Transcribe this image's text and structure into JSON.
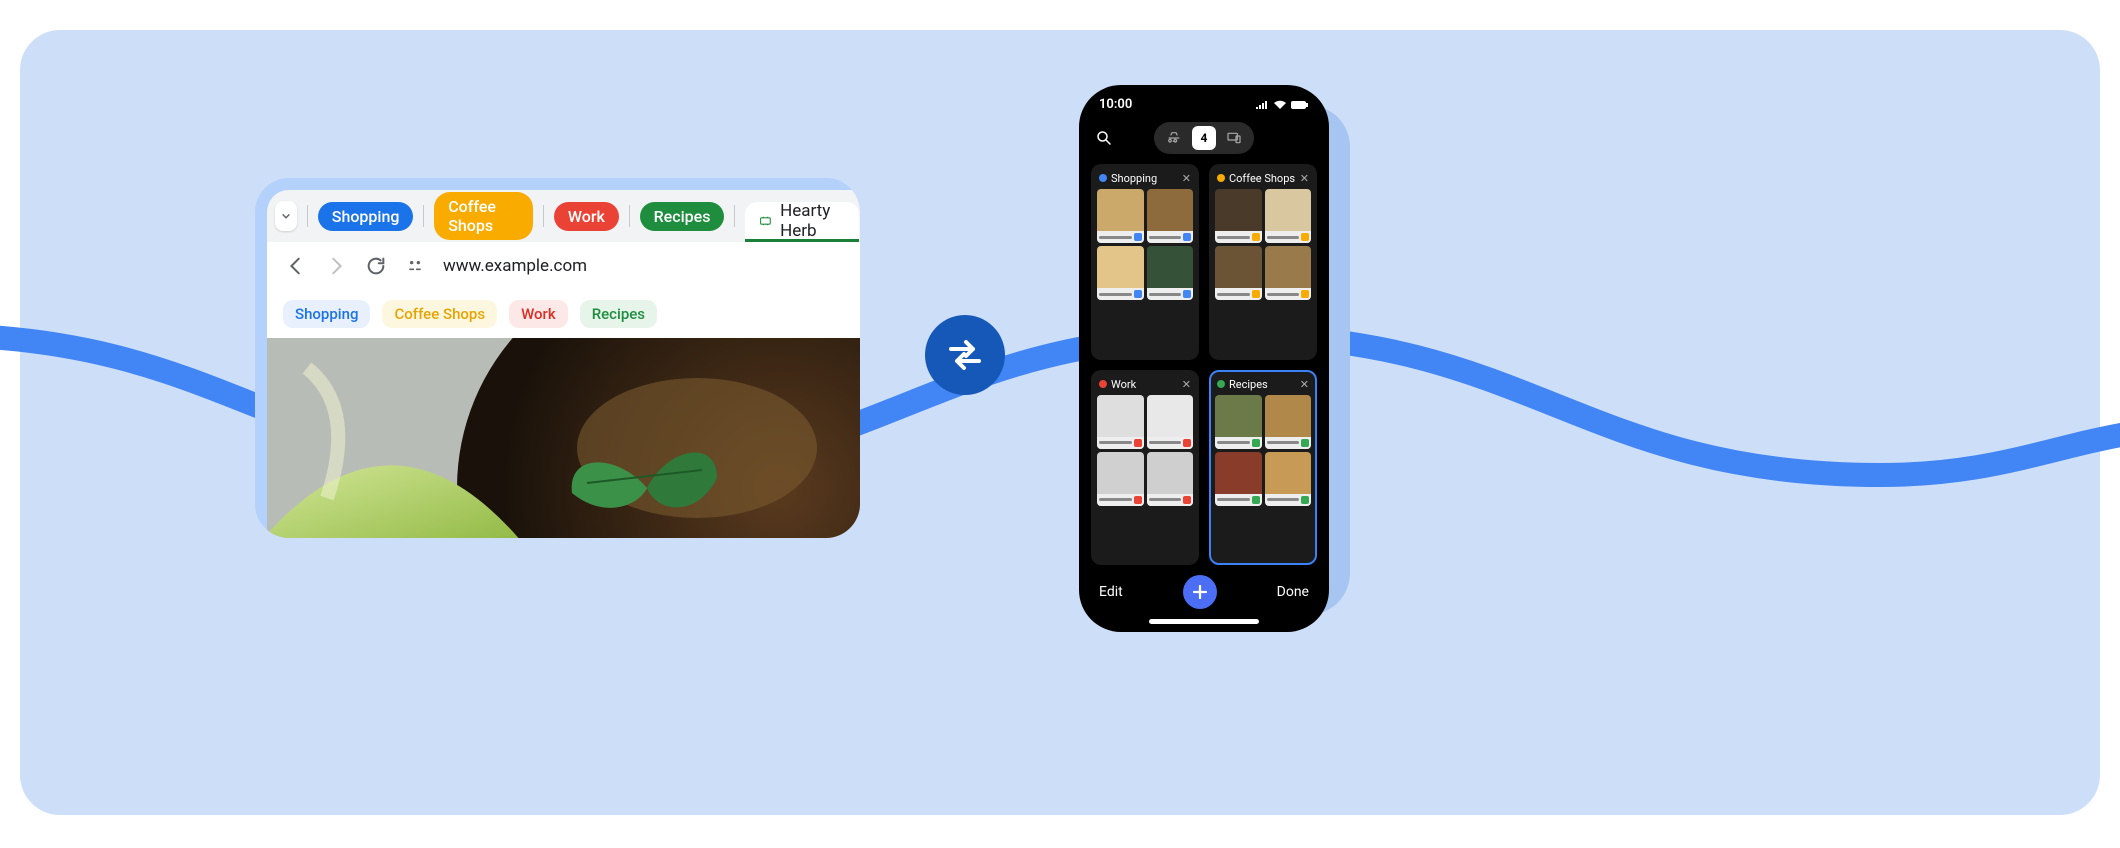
{
  "colors": {
    "blue": "#1a73e8",
    "orange": "#f9ab00",
    "red": "#ea4335",
    "green": "#1e8e3e",
    "chip_blue_bg": "#e8f0fe",
    "chip_blue_fg": "#1a73e8",
    "chip_orange_bg": "#fef7e0",
    "chip_orange_fg": "#e8a300",
    "chip_red_bg": "#fce8e6",
    "chip_red_fg": "#d93025",
    "chip_green_bg": "#e6f4ea",
    "chip_green_fg": "#1e8e3e"
  },
  "browser": {
    "tab_groups": [
      {
        "label": "Shopping",
        "color": "blue"
      },
      {
        "label": "Coffee Shops",
        "color": "orange"
      },
      {
        "label": "Work",
        "color": "red"
      },
      {
        "label": "Recipes",
        "color": "green"
      }
    ],
    "active_tab": {
      "label": "Hearty Herb",
      "icon": "site-icon"
    },
    "address": "www.example.com",
    "bookmark_chips": [
      {
        "label": "Shopping",
        "color": "blue"
      },
      {
        "label": "Coffee Shops",
        "color": "orange"
      },
      {
        "label": "Work",
        "color": "red"
      },
      {
        "label": "Recipes",
        "color": "green"
      }
    ]
  },
  "phone": {
    "time": "10:00",
    "segment_count": "4",
    "groups": [
      {
        "label": "Shopping",
        "color": "blue",
        "selected": false
      },
      {
        "label": "Coffee Shops",
        "color": "orange",
        "selected": false
      },
      {
        "label": "Work",
        "color": "red",
        "selected": false
      },
      {
        "label": "Recipes",
        "color": "green",
        "selected": true
      }
    ],
    "edit_label": "Edit",
    "done_label": "Done"
  }
}
